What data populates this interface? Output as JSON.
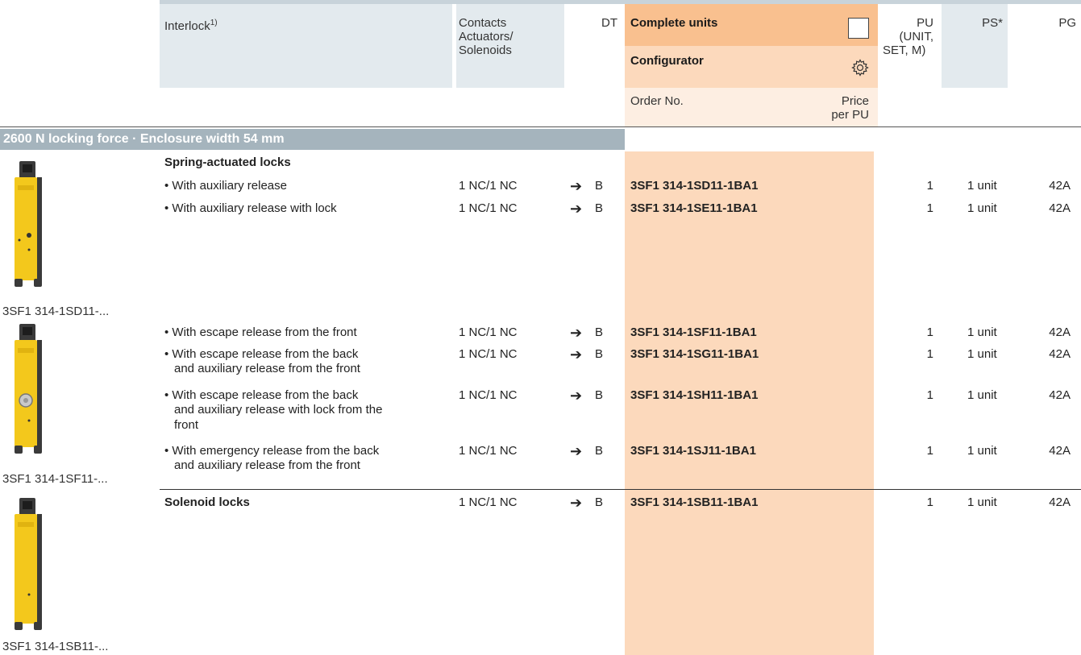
{
  "header": {
    "interlock": "Interlock",
    "interlock_sup": "1)",
    "contacts_line1": "Contacts",
    "contacts_line2": "Actuators/",
    "contacts_line3": "Solenoids",
    "dt": "DT",
    "complete_units": "Complete units",
    "configurator": "Configurator",
    "order_no": "Order No.",
    "price_line1": "Price",
    "price_line2": "per PU",
    "pu_line1": "PU",
    "pu_line2": "(UNIT,",
    "pu_line3": "SET, M)",
    "ps": "PS*",
    "pg": "PG"
  },
  "section_title": "2600 N locking force · Enclosure width 54 mm",
  "groups": {
    "spring_title": "Spring-actuated locks",
    "solenoid_title": "Solenoid locks"
  },
  "rows": [
    {
      "desc1": "• With auxiliary release",
      "desc2": "",
      "desc3": "",
      "contacts": "1 NC/1 NC",
      "dt": "B",
      "order": "3SF1 314-1SD11-1BA1",
      "pu": "1",
      "ps": "1 unit",
      "pg": "42A"
    },
    {
      "desc1": "• With auxiliary release with lock",
      "desc2": "",
      "desc3": "",
      "contacts": "1 NC/1 NC",
      "dt": "B",
      "order": "3SF1 314-1SE11-1BA1",
      "pu": "1",
      "ps": "1 unit",
      "pg": "42A"
    },
    {
      "desc1": "• With escape release from the front",
      "desc2": "",
      "desc3": "",
      "contacts": "1 NC/1 NC",
      "dt": "B",
      "order": "3SF1 314-1SF11-1BA1",
      "pu": "1",
      "ps": "1 unit",
      "pg": "42A"
    },
    {
      "desc1": "• With escape release from the back",
      "desc2": "and auxiliary release from the front",
      "desc3": "",
      "contacts": "1 NC/1 NC",
      "dt": "B",
      "order": "3SF1 314-1SG11-1BA1",
      "pu": "1",
      "ps": "1 unit",
      "pg": "42A"
    },
    {
      "desc1": "• With escape release from the back",
      "desc2": "and auxiliary release with lock from the",
      "desc3": "front",
      "contacts": "1 NC/1 NC",
      "dt": "B",
      "order": "3SF1 314-1SH11-1BA1",
      "pu": "1",
      "ps": "1 unit",
      "pg": "42A"
    },
    {
      "desc1": "• With emergency release from the back",
      "desc2": "and auxiliary release from the front",
      "desc3": "",
      "contacts": "1 NC/1 NC",
      "dt": "B",
      "order": "3SF1 314-1SJ11-1BA1",
      "pu": "1",
      "ps": "1 unit",
      "pg": "42A"
    },
    {
      "desc1": "",
      "desc2": "",
      "desc3": "",
      "contacts": "1 NC/1 NC",
      "dt": "B",
      "order": "3SF1 314-1SB11-1BA1",
      "pu": "1",
      "ps": "1 unit",
      "pg": "42A"
    }
  ],
  "products": [
    {
      "caption": "3SF1 314-1SD11-..."
    },
    {
      "caption": "3SF1 314-1SF11-..."
    },
    {
      "caption": "3SF1 314-1SB11-..."
    }
  ],
  "colors": {
    "header_bg": "#e3eaee",
    "section_bar": "#a5b4bd",
    "orange_dark": "#f9c08f",
    "orange_light": "#fcd9bc",
    "device_yellow": "#f3c81c",
    "device_black": "#3a3a3a"
  },
  "icons": {
    "checkbox": "empty-checkbox-icon",
    "configurator": "gear-icon",
    "delivery": "arrow-right-circle-icon"
  }
}
